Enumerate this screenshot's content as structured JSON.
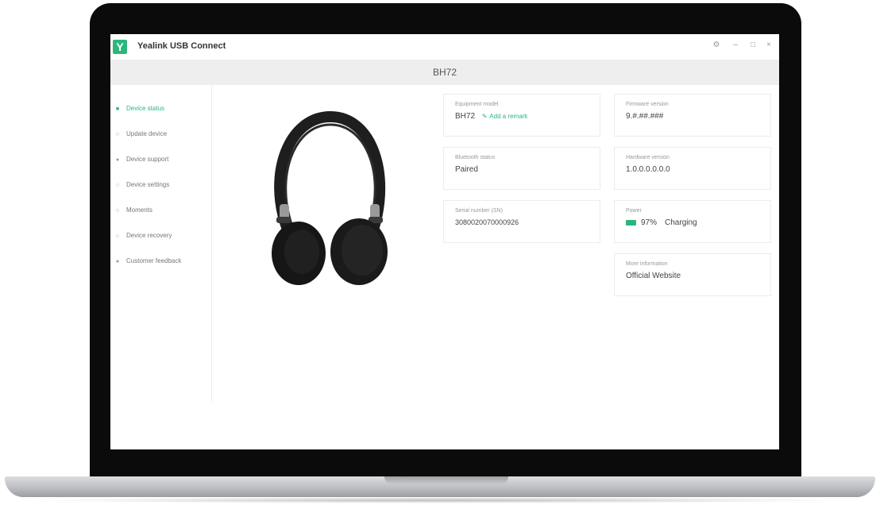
{
  "app": {
    "logo_letter": "Y",
    "title": "Yealink USB Connect",
    "window_controls": [
      "⚙",
      "–",
      "□",
      "×"
    ]
  },
  "device_bar": {
    "device_name": "BH72"
  },
  "sidebar": {
    "items": [
      {
        "label": "Device status",
        "active": true
      },
      {
        "label": "Update device",
        "active": false
      },
      {
        "label": "Device support",
        "active": false
      },
      {
        "label": "Device settings",
        "active": false
      },
      {
        "label": "Moments",
        "active": false
      },
      {
        "label": "Device recovery",
        "active": false
      },
      {
        "label": "Customer feedback",
        "active": false
      }
    ]
  },
  "cards": {
    "equipment_model": {
      "label": "Equipment model",
      "value": "BH72",
      "action": "Add a remark"
    },
    "firmware_version": {
      "label": "Firmware version",
      "value": "9.#.##.###"
    },
    "bluetooth_status": {
      "label": "Bluetooth status",
      "value": "Paired"
    },
    "hardware_version": {
      "label": "Hardware version",
      "value": "1.0.0.0.0.0.0"
    },
    "serial_number": {
      "label": "Serial number (SN)",
      "value": "3080020070000926"
    },
    "power": {
      "label": "Power",
      "percent": "97%",
      "status": "Charging",
      "accent": "#2cb67d"
    },
    "more_information": {
      "label": "More information",
      "link": "Official Website"
    }
  },
  "colors": {
    "accent": "#2cb67d",
    "devbar": "#eeeeee"
  }
}
